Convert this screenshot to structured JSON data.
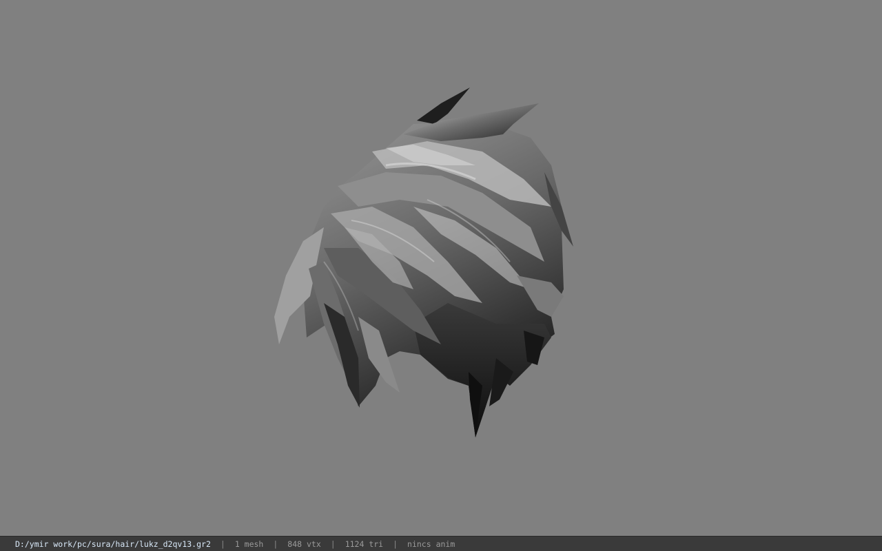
{
  "viewport": {
    "background_color": "#808080",
    "model": {
      "icon": "hair-mesh-render",
      "colors": {
        "dark": "#141414",
        "mid": "#5a5a5a",
        "light": "#bdbdbd",
        "highlight": "#e2e2e2"
      }
    }
  },
  "status_bar": {
    "file_path": "D:/ymir work/pc/sura/hair/lukz_d2qv13.gr2",
    "separator": "|",
    "mesh_count": "1 mesh",
    "vertex_count": "848 vtx",
    "triangle_count": "1124 tri",
    "anim_status": "nincs anim"
  }
}
